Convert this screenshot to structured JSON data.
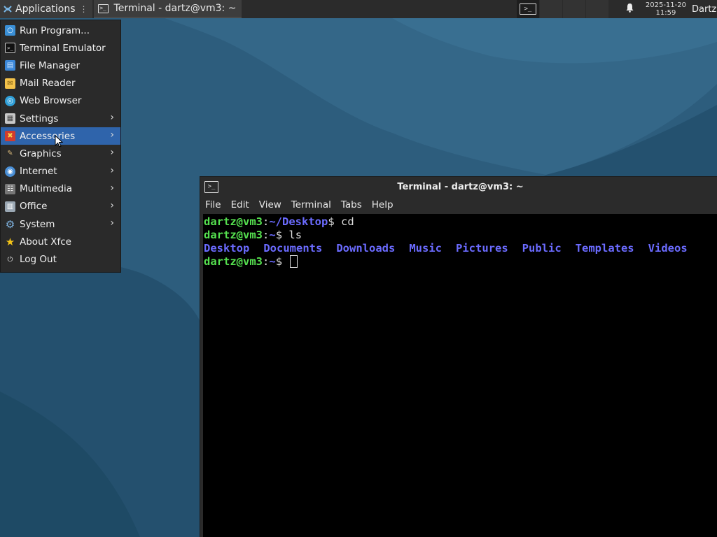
{
  "panel": {
    "applications_label": "Applications",
    "separator_glyph": "⋮",
    "task_title": "Terminal - dartz@vm3: ~",
    "clock_date": "2025-11-20",
    "clock_time": "11:59",
    "user": "Dartz"
  },
  "menu": {
    "items": [
      {
        "label": "Run Program...",
        "icon": "search-icon",
        "submenu": false
      },
      {
        "label": "Terminal Emulator",
        "icon": "terminal-icon",
        "submenu": false
      },
      {
        "label": "File Manager",
        "icon": "folder-icon",
        "submenu": false
      },
      {
        "label": "Mail Reader",
        "icon": "mail-icon",
        "submenu": false
      },
      {
        "label": "Web Browser",
        "icon": "globe-icon",
        "submenu": false
      },
      {
        "label": "Settings",
        "icon": "settings-icon",
        "submenu": true
      },
      {
        "label": "Accessories",
        "icon": "accessories-icon",
        "submenu": true,
        "highlighted": true
      },
      {
        "label": "Graphics",
        "icon": "brush-icon",
        "submenu": true
      },
      {
        "label": "Internet",
        "icon": "internet-icon",
        "submenu": true
      },
      {
        "label": "Multimedia",
        "icon": "multimedia-icon",
        "submenu": true
      },
      {
        "label": "Office",
        "icon": "office-icon",
        "submenu": true
      },
      {
        "label": "System",
        "icon": "gear-icon",
        "submenu": true
      },
      {
        "label": "About Xfce",
        "icon": "star-icon",
        "submenu": false
      },
      {
        "label": "Log Out",
        "icon": "logout-icon",
        "submenu": false
      }
    ]
  },
  "terminal": {
    "title": "Terminal - dartz@vm3: ~",
    "menubar": [
      "File",
      "Edit",
      "View",
      "Terminal",
      "Tabs",
      "Help"
    ],
    "lines": [
      {
        "user": "dartz@vm3",
        "sep": ":",
        "path": "~/Desktop",
        "prompt": "$ ",
        "cmd": "cd"
      },
      {
        "user": "dartz@vm3",
        "sep": ":",
        "path": "~",
        "prompt": "$ ",
        "cmd": "ls"
      }
    ],
    "ls_output": [
      "Desktop",
      "Documents",
      "Downloads",
      "Music",
      "Pictures",
      "Public",
      "Templates",
      "Videos"
    ],
    "current_prompt": {
      "user": "dartz@vm3",
      "sep": ":",
      "path": "~",
      "prompt": "$ "
    }
  },
  "colors": {
    "panel_bg": "#2b2b2b",
    "menu_highlight": "#2f64ab",
    "prompt_user": "#55e04f",
    "prompt_path": "#6b6bff",
    "desktop_bg": "#2b5a7a"
  }
}
